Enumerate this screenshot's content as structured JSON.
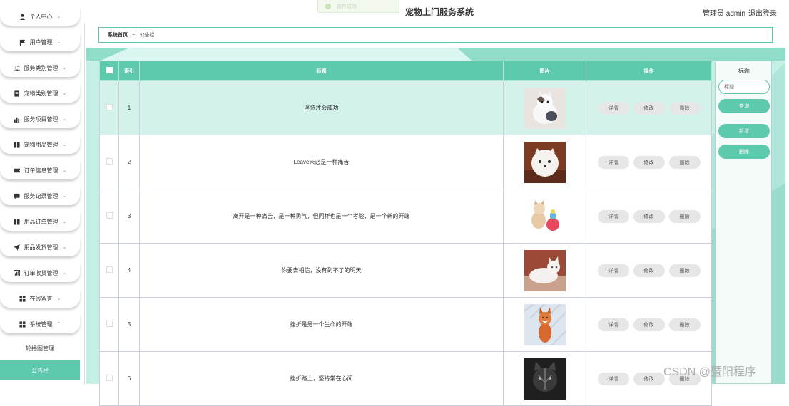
{
  "app_title": "宠物上门服务系统",
  "header": {
    "admin_label": "管理员 admin",
    "logout_label": "退出登录",
    "toast_text": "操作成功"
  },
  "breadcrumb": {
    "home": "系统首页",
    "separator": "Ξ",
    "current": "公告栏"
  },
  "sidebar": {
    "items": [
      {
        "label": "个人中心",
        "icon": "user-icon"
      },
      {
        "label": "用户管理",
        "icon": "flag-icon"
      },
      {
        "label": "服务类别管理",
        "icon": "sliders-icon"
      },
      {
        "label": "宠物类别管理",
        "icon": "document-icon"
      },
      {
        "label": "服务项目管理",
        "icon": "bar-chart-icon"
      },
      {
        "label": "宠物用品管理",
        "icon": "grid-icon"
      },
      {
        "label": "订单信息管理",
        "icon": "ticket-icon"
      },
      {
        "label": "服务记录管理",
        "icon": "message-icon"
      },
      {
        "label": "用品订单管理",
        "icon": "grid-icon"
      },
      {
        "label": "用品发货管理",
        "icon": "send-icon"
      },
      {
        "label": "订单收货管理",
        "icon": "chart-icon"
      },
      {
        "label": "在线留言",
        "icon": "grid-icon"
      },
      {
        "label": "系统管理",
        "icon": "grid-icon"
      }
    ],
    "sub_items": [
      {
        "label": "轮播图管理",
        "active": false
      },
      {
        "label": "公告栏",
        "active": true
      }
    ]
  },
  "table": {
    "columns": [
      "索引",
      "标题",
      "图片",
      "操作"
    ],
    "rows": [
      {
        "index": "1",
        "title": "坚持才会成功",
        "image": "cat-white-gray"
      },
      {
        "index": "2",
        "title": "Leave未必是一种痛苦",
        "image": "pomeranian"
      },
      {
        "index": "3",
        "title": "离开是一种痛苦，是一种勇气，但同样也是一个考验，是一个新的开端",
        "image": "cat-with-toy"
      },
      {
        "index": "4",
        "title": "你要去相信，没有到不了的明天",
        "image": "white-cat"
      },
      {
        "index": "5",
        "title": "挫折是另一个生命的开端",
        "image": "fox-in-snow"
      },
      {
        "index": "6",
        "title": "挫折路上，坚持常在心间",
        "image": "dark-cat"
      }
    ],
    "actions": {
      "detail": "详情",
      "edit": "修改",
      "delete": "删除"
    }
  },
  "search_panel": {
    "label": "标题",
    "placeholder": "标题",
    "query_label": "查询",
    "add_label": "新增",
    "delete_label": "删除"
  },
  "watermark": "CSDN @暨阳程序",
  "colors": {
    "accent": "#5dc9ad",
    "panel_bg": "#c5f0e6"
  }
}
